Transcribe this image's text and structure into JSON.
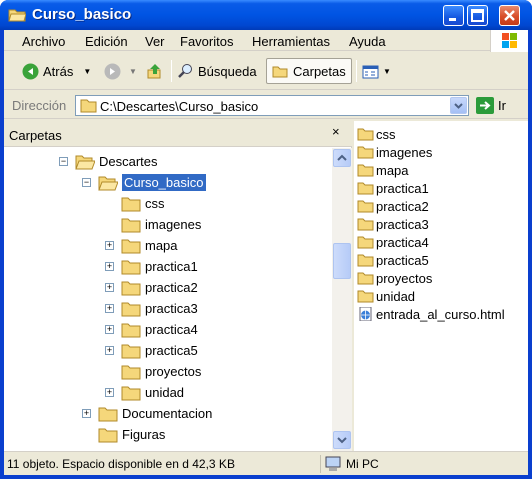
{
  "window": {
    "title": "Curso_basico"
  },
  "colors": {
    "titlebar": "#0054e3",
    "selection": "#316ac5",
    "folder": "#f5d77b",
    "chrome": "#ece9d8"
  },
  "menubar": {
    "items": [
      "Archivo",
      "Edición",
      "Ver",
      "Favoritos",
      "Herramientas",
      "Ayuda"
    ]
  },
  "toolbar": {
    "back": "Atrás",
    "search": "Búsqueda",
    "folders": "Carpetas"
  },
  "address": {
    "label": "Dirección",
    "value": "C:\\Descartes\\Curso_basico",
    "go": "Ir"
  },
  "folder_pane": {
    "title": "Carpetas",
    "close": "×"
  },
  "tree": [
    {
      "label": "Descartes",
      "expander": "−",
      "icon": "folder-open-icon"
    },
    {
      "label": "Curso_basico",
      "expander": "−",
      "icon": "folder-open-icon",
      "selected": true
    },
    {
      "label": "css",
      "expander": "",
      "icon": "folder-icon"
    },
    {
      "label": "imagenes",
      "expander": "",
      "icon": "folder-icon"
    },
    {
      "label": "mapa",
      "expander": "+",
      "icon": "folder-icon"
    },
    {
      "label": "practica1",
      "expander": "+",
      "icon": "folder-icon"
    },
    {
      "label": "practica2",
      "expander": "+",
      "icon": "folder-icon"
    },
    {
      "label": "practica3",
      "expander": "+",
      "icon": "folder-icon"
    },
    {
      "label": "practica4",
      "expander": "+",
      "icon": "folder-icon"
    },
    {
      "label": "practica5",
      "expander": "+",
      "icon": "folder-icon"
    },
    {
      "label": "proyectos",
      "expander": "",
      "icon": "folder-icon"
    },
    {
      "label": "unidad",
      "expander": "+",
      "icon": "folder-icon"
    },
    {
      "label": "Documentacion",
      "expander": "+",
      "icon": "folder-icon"
    },
    {
      "label": "Figuras",
      "expander": "",
      "icon": "folder-icon"
    }
  ],
  "files": [
    {
      "name": "css",
      "icon": "folder-icon"
    },
    {
      "name": "imagenes",
      "icon": "folder-icon"
    },
    {
      "name": "mapa",
      "icon": "folder-icon"
    },
    {
      "name": "practica1",
      "icon": "folder-icon"
    },
    {
      "name": "practica2",
      "icon": "folder-icon"
    },
    {
      "name": "practica3",
      "icon": "folder-icon"
    },
    {
      "name": "practica4",
      "icon": "folder-icon"
    },
    {
      "name": "practica5",
      "icon": "folder-icon"
    },
    {
      "name": "proyectos",
      "icon": "folder-icon"
    },
    {
      "name": "unidad",
      "icon": "folder-icon"
    },
    {
      "name": "entrada_al_curso.html",
      "icon": "html-file-icon"
    }
  ],
  "status": {
    "objects": "11 objeto. Espacio disponible en d 42,3 KB",
    "location": "Mi PC"
  }
}
